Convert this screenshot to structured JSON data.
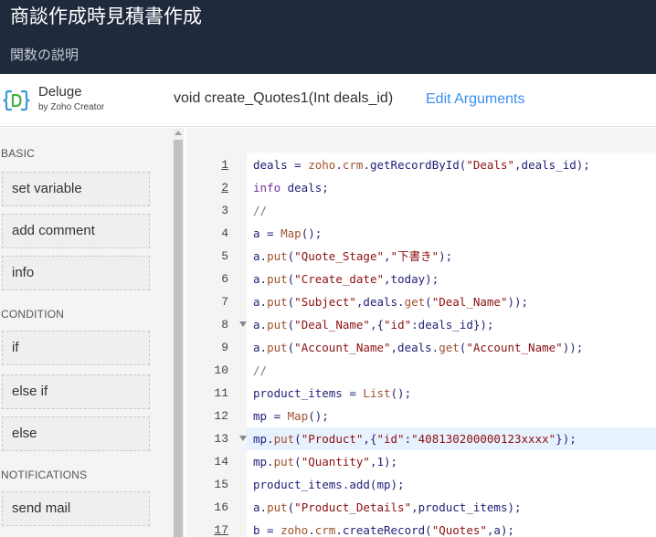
{
  "header": {
    "title": "商談作成時見積書作成",
    "subtitle": "関数の説明"
  },
  "toolbar": {
    "brand_name": "Deluge",
    "brand_sub": "by Zoho Creator",
    "signature": "void  create_Quotes1(Int deals_id)",
    "edit_arguments": "Edit Arguments"
  },
  "sidebar": {
    "sections": [
      {
        "label": "BASIC",
        "items": [
          "set variable",
          "add comment",
          "info"
        ]
      },
      {
        "label": "CONDITION",
        "items": [
          "if",
          "else if",
          "else"
        ]
      },
      {
        "label": "NOTIFICATIONS",
        "items": [
          "send mail"
        ]
      }
    ]
  },
  "editor": {
    "highlighted_line": 13,
    "lines": [
      {
        "n": "1",
        "ul": true,
        "fold": false,
        "tokens": [
          [
            "deals = ",
            "plain"
          ],
          [
            "zoho",
            "fn"
          ],
          [
            ".",
            "plain"
          ],
          [
            "crm",
            "fn"
          ],
          [
            ".getRecordById(",
            "plain"
          ],
          [
            "\"Deals\"",
            "str"
          ],
          [
            ",deals_id);",
            "plain"
          ]
        ]
      },
      {
        "n": "2",
        "ul": true,
        "fold": false,
        "tokens": [
          [
            "info",
            "kw"
          ],
          [
            " deals;",
            "plain"
          ]
        ]
      },
      {
        "n": "3",
        "ul": false,
        "fold": false,
        "tokens": [
          [
            "//",
            "cm"
          ]
        ]
      },
      {
        "n": "4",
        "ul": false,
        "fold": false,
        "tokens": [
          [
            "a = ",
            "plain"
          ],
          [
            "Map",
            "fn"
          ],
          [
            "();",
            "plain"
          ]
        ]
      },
      {
        "n": "5",
        "ul": false,
        "fold": false,
        "tokens": [
          [
            "a.",
            "plain"
          ],
          [
            "put",
            "fn"
          ],
          [
            "(",
            "plain"
          ],
          [
            "\"Quote_Stage\"",
            "str"
          ],
          [
            ",",
            "plain"
          ],
          [
            "\"下書き\"",
            "str"
          ],
          [
            ");",
            "plain"
          ]
        ]
      },
      {
        "n": "6",
        "ul": false,
        "fold": false,
        "tokens": [
          [
            "a.",
            "plain"
          ],
          [
            "put",
            "fn"
          ],
          [
            "(",
            "plain"
          ],
          [
            "\"Create_date\"",
            "str"
          ],
          [
            ",today);",
            "plain"
          ]
        ]
      },
      {
        "n": "7",
        "ul": false,
        "fold": false,
        "tokens": [
          [
            "a.",
            "plain"
          ],
          [
            "put",
            "fn"
          ],
          [
            "(",
            "plain"
          ],
          [
            "\"Subject\"",
            "str"
          ],
          [
            ",deals.",
            "plain"
          ],
          [
            "get",
            "fn"
          ],
          [
            "(",
            "plain"
          ],
          [
            "\"Deal_Name\"",
            "str"
          ],
          [
            "));",
            "plain"
          ]
        ]
      },
      {
        "n": "8",
        "ul": false,
        "fold": true,
        "tokens": [
          [
            "a.",
            "plain"
          ],
          [
            "put",
            "fn"
          ],
          [
            "(",
            "plain"
          ],
          [
            "\"Deal_Name\"",
            "str"
          ],
          [
            ",{",
            "plain"
          ],
          [
            "\"id\"",
            "str"
          ],
          [
            ":deals_id});",
            "plain"
          ]
        ]
      },
      {
        "n": "9",
        "ul": false,
        "fold": false,
        "tokens": [
          [
            "a.",
            "plain"
          ],
          [
            "put",
            "fn"
          ],
          [
            "(",
            "plain"
          ],
          [
            "\"Account_Name\"",
            "str"
          ],
          [
            ",deals.",
            "plain"
          ],
          [
            "get",
            "fn"
          ],
          [
            "(",
            "plain"
          ],
          [
            "\"Account_Name\"",
            "str"
          ],
          [
            "));",
            "plain"
          ]
        ]
      },
      {
        "n": "10",
        "ul": false,
        "fold": false,
        "tokens": [
          [
            "//",
            "cm"
          ]
        ]
      },
      {
        "n": "11",
        "ul": false,
        "fold": false,
        "tokens": [
          [
            "product_items = ",
            "plain"
          ],
          [
            "List",
            "fn"
          ],
          [
            "();",
            "plain"
          ]
        ]
      },
      {
        "n": "12",
        "ul": false,
        "fold": false,
        "tokens": [
          [
            "mp = ",
            "plain"
          ],
          [
            "Map",
            "fn"
          ],
          [
            "();",
            "plain"
          ]
        ]
      },
      {
        "n": "13",
        "ul": false,
        "fold": true,
        "tokens": [
          [
            "mp.",
            "plain"
          ],
          [
            "put",
            "fn"
          ],
          [
            "(",
            "plain"
          ],
          [
            "\"Product\"",
            "str"
          ],
          [
            ",{",
            "plain"
          ],
          [
            "\"id\"",
            "str"
          ],
          [
            ":",
            "plain"
          ],
          [
            "\"408130200000123xxxx\"",
            "str"
          ],
          [
            "});",
            "plain"
          ]
        ]
      },
      {
        "n": "14",
        "ul": false,
        "fold": false,
        "tokens": [
          [
            "mp.",
            "plain"
          ],
          [
            "put",
            "fn"
          ],
          [
            "(",
            "plain"
          ],
          [
            "\"Quantity\"",
            "str"
          ],
          [
            ",1);",
            "plain"
          ]
        ]
      },
      {
        "n": "15",
        "ul": false,
        "fold": false,
        "tokens": [
          [
            "product_items.add(mp);",
            "plain"
          ]
        ]
      },
      {
        "n": "16",
        "ul": false,
        "fold": false,
        "tokens": [
          [
            "a.",
            "plain"
          ],
          [
            "put",
            "fn"
          ],
          [
            "(",
            "plain"
          ],
          [
            "\"Product_Details\"",
            "str"
          ],
          [
            ",product_items);",
            "plain"
          ]
        ]
      },
      {
        "n": "17",
        "ul": true,
        "fold": false,
        "tokens": [
          [
            "b = ",
            "plain"
          ],
          [
            "zoho",
            "fn"
          ],
          [
            ".",
            "plain"
          ],
          [
            "crm",
            "fn"
          ],
          [
            ".createRecord(",
            "plain"
          ],
          [
            "\"Quotes\"",
            "str"
          ],
          [
            ",a);",
            "plain"
          ]
        ]
      }
    ]
  },
  "colors": {
    "header_bg": "#1f2a3d",
    "accent_link": "#3d8ef0",
    "highlight_line_bg": "#e8f2fe"
  },
  "icons": {
    "logo": "deluge-logo-icon"
  }
}
